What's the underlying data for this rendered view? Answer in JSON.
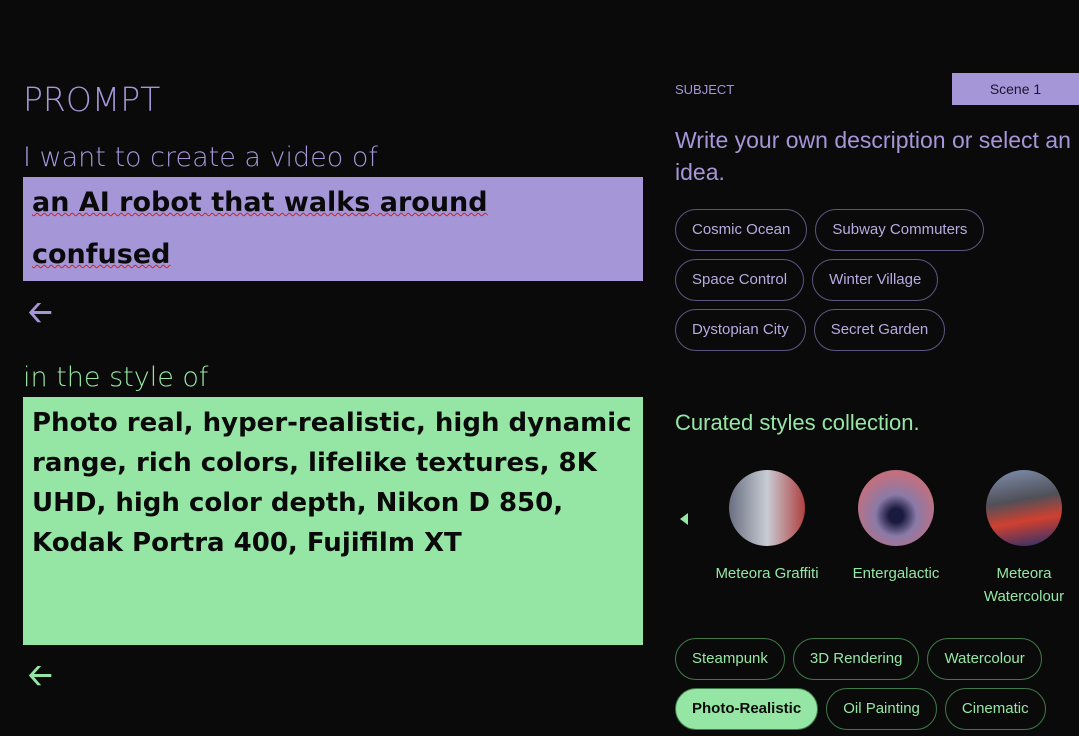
{
  "prompt": {
    "title": "PROMPT",
    "subject_lead": "I want to create a video of",
    "subject_text": "an AI robot that walks around confused",
    "style_lead": "in the style of",
    "style_text": "Photo real, hyper-realistic, high dynamic range, rich colors, lifelike textures, 8K UHD, high color depth, Nikon D 850, Kodak Portra 400, Fujifilm XT",
    "back_icon": "arrow-left-icon"
  },
  "subject": {
    "label": "SUBJECT",
    "scene": "Scene 1",
    "description": "Write your own description or select an idea.",
    "ideas": [
      "Cosmic Ocean",
      "Subway Commuters",
      "Space Control",
      "Winter Village",
      "Dystopian City",
      "Secret Garden"
    ]
  },
  "styles": {
    "heading": "Curated styles collection.",
    "curated": [
      {
        "name": "Meteora Graffiti"
      },
      {
        "name": "Entergalactic"
      },
      {
        "name": "Meteora Watercolour"
      }
    ],
    "chips": [
      {
        "label": "Steampunk",
        "selected": false
      },
      {
        "label": "3D Rendering",
        "selected": false
      },
      {
        "label": "Watercolour",
        "selected": false
      },
      {
        "label": "Photo-Realistic",
        "selected": true
      },
      {
        "label": "Oil Painting",
        "selected": false
      },
      {
        "label": "Cinematic",
        "selected": false
      }
    ]
  },
  "colors": {
    "purple": "#a596d8",
    "green": "#95e6a5",
    "background": "#0b0a0b"
  }
}
